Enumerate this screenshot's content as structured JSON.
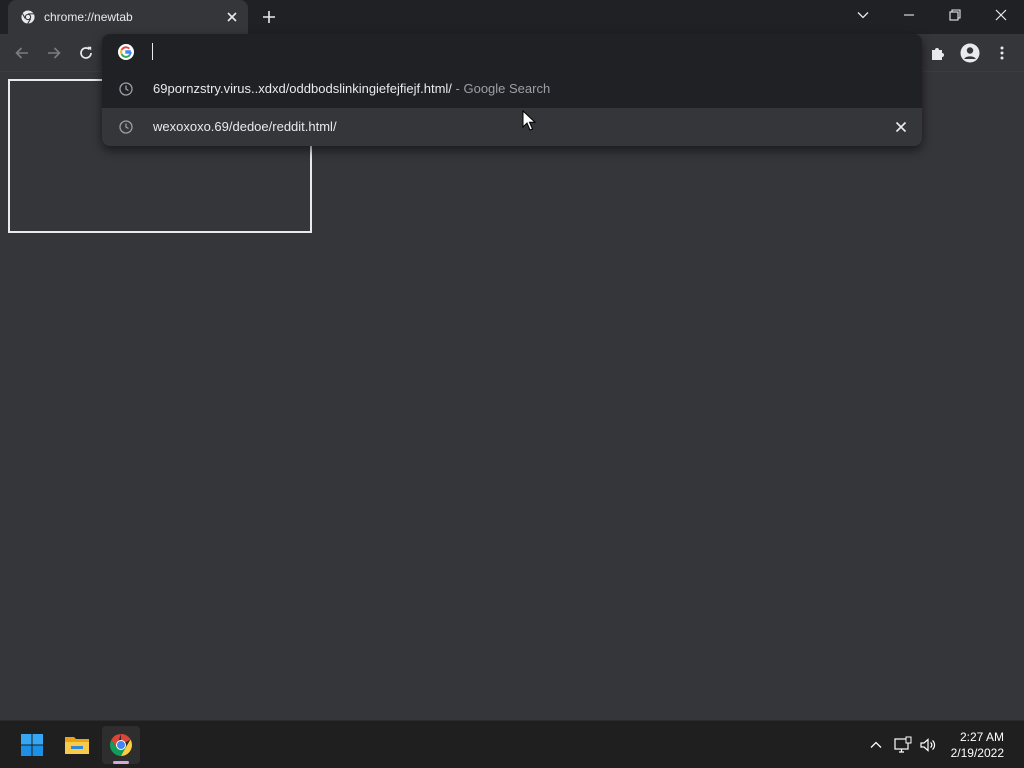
{
  "tab": {
    "title": "chrome://newtab",
    "favicon": "chrome-icon"
  },
  "window_controls": {
    "tab_search": "chevron-down-icon",
    "minimize": "minimize-icon",
    "restore": "restore-icon",
    "close": "close-icon"
  },
  "toolbar": {
    "back": "back-arrow-icon",
    "forward": "forward-arrow-icon",
    "reload": "reload-icon",
    "extensions": "puzzle-icon",
    "profile": "profile-icon",
    "menu": "more-vert-icon"
  },
  "omnibox": {
    "value": "",
    "placeholder": "",
    "suggestions": [
      {
        "icon": "history-clock-icon",
        "text": "69pornzstry.virus..xdxd/oddbodslinkingiefejfiejf.html/",
        "description": "- Google Search"
      },
      {
        "icon": "history-clock-icon",
        "text": "wexoxoxo.69/dedoe/reddit.html/",
        "description": ""
      }
    ]
  },
  "taskbar": {
    "apps": [
      "windows-start-icon",
      "file-explorer-icon",
      "chrome-icon"
    ],
    "tray": [
      "chevron-up-icon",
      "network-icon",
      "volume-icon"
    ],
    "time": "2:27 AM",
    "date": "2/19/2022"
  },
  "colors": {
    "tabstrip_bg": "#202124",
    "toolbar_bg": "#35363a",
    "page_bg": "#35363a",
    "popup_bg": "#202124",
    "text": "#e8eaed",
    "muted_text": "#9aa0a6",
    "taskbar_bg": "#1f1f1f",
    "chrome_indicator": "#d6a6d8"
  }
}
